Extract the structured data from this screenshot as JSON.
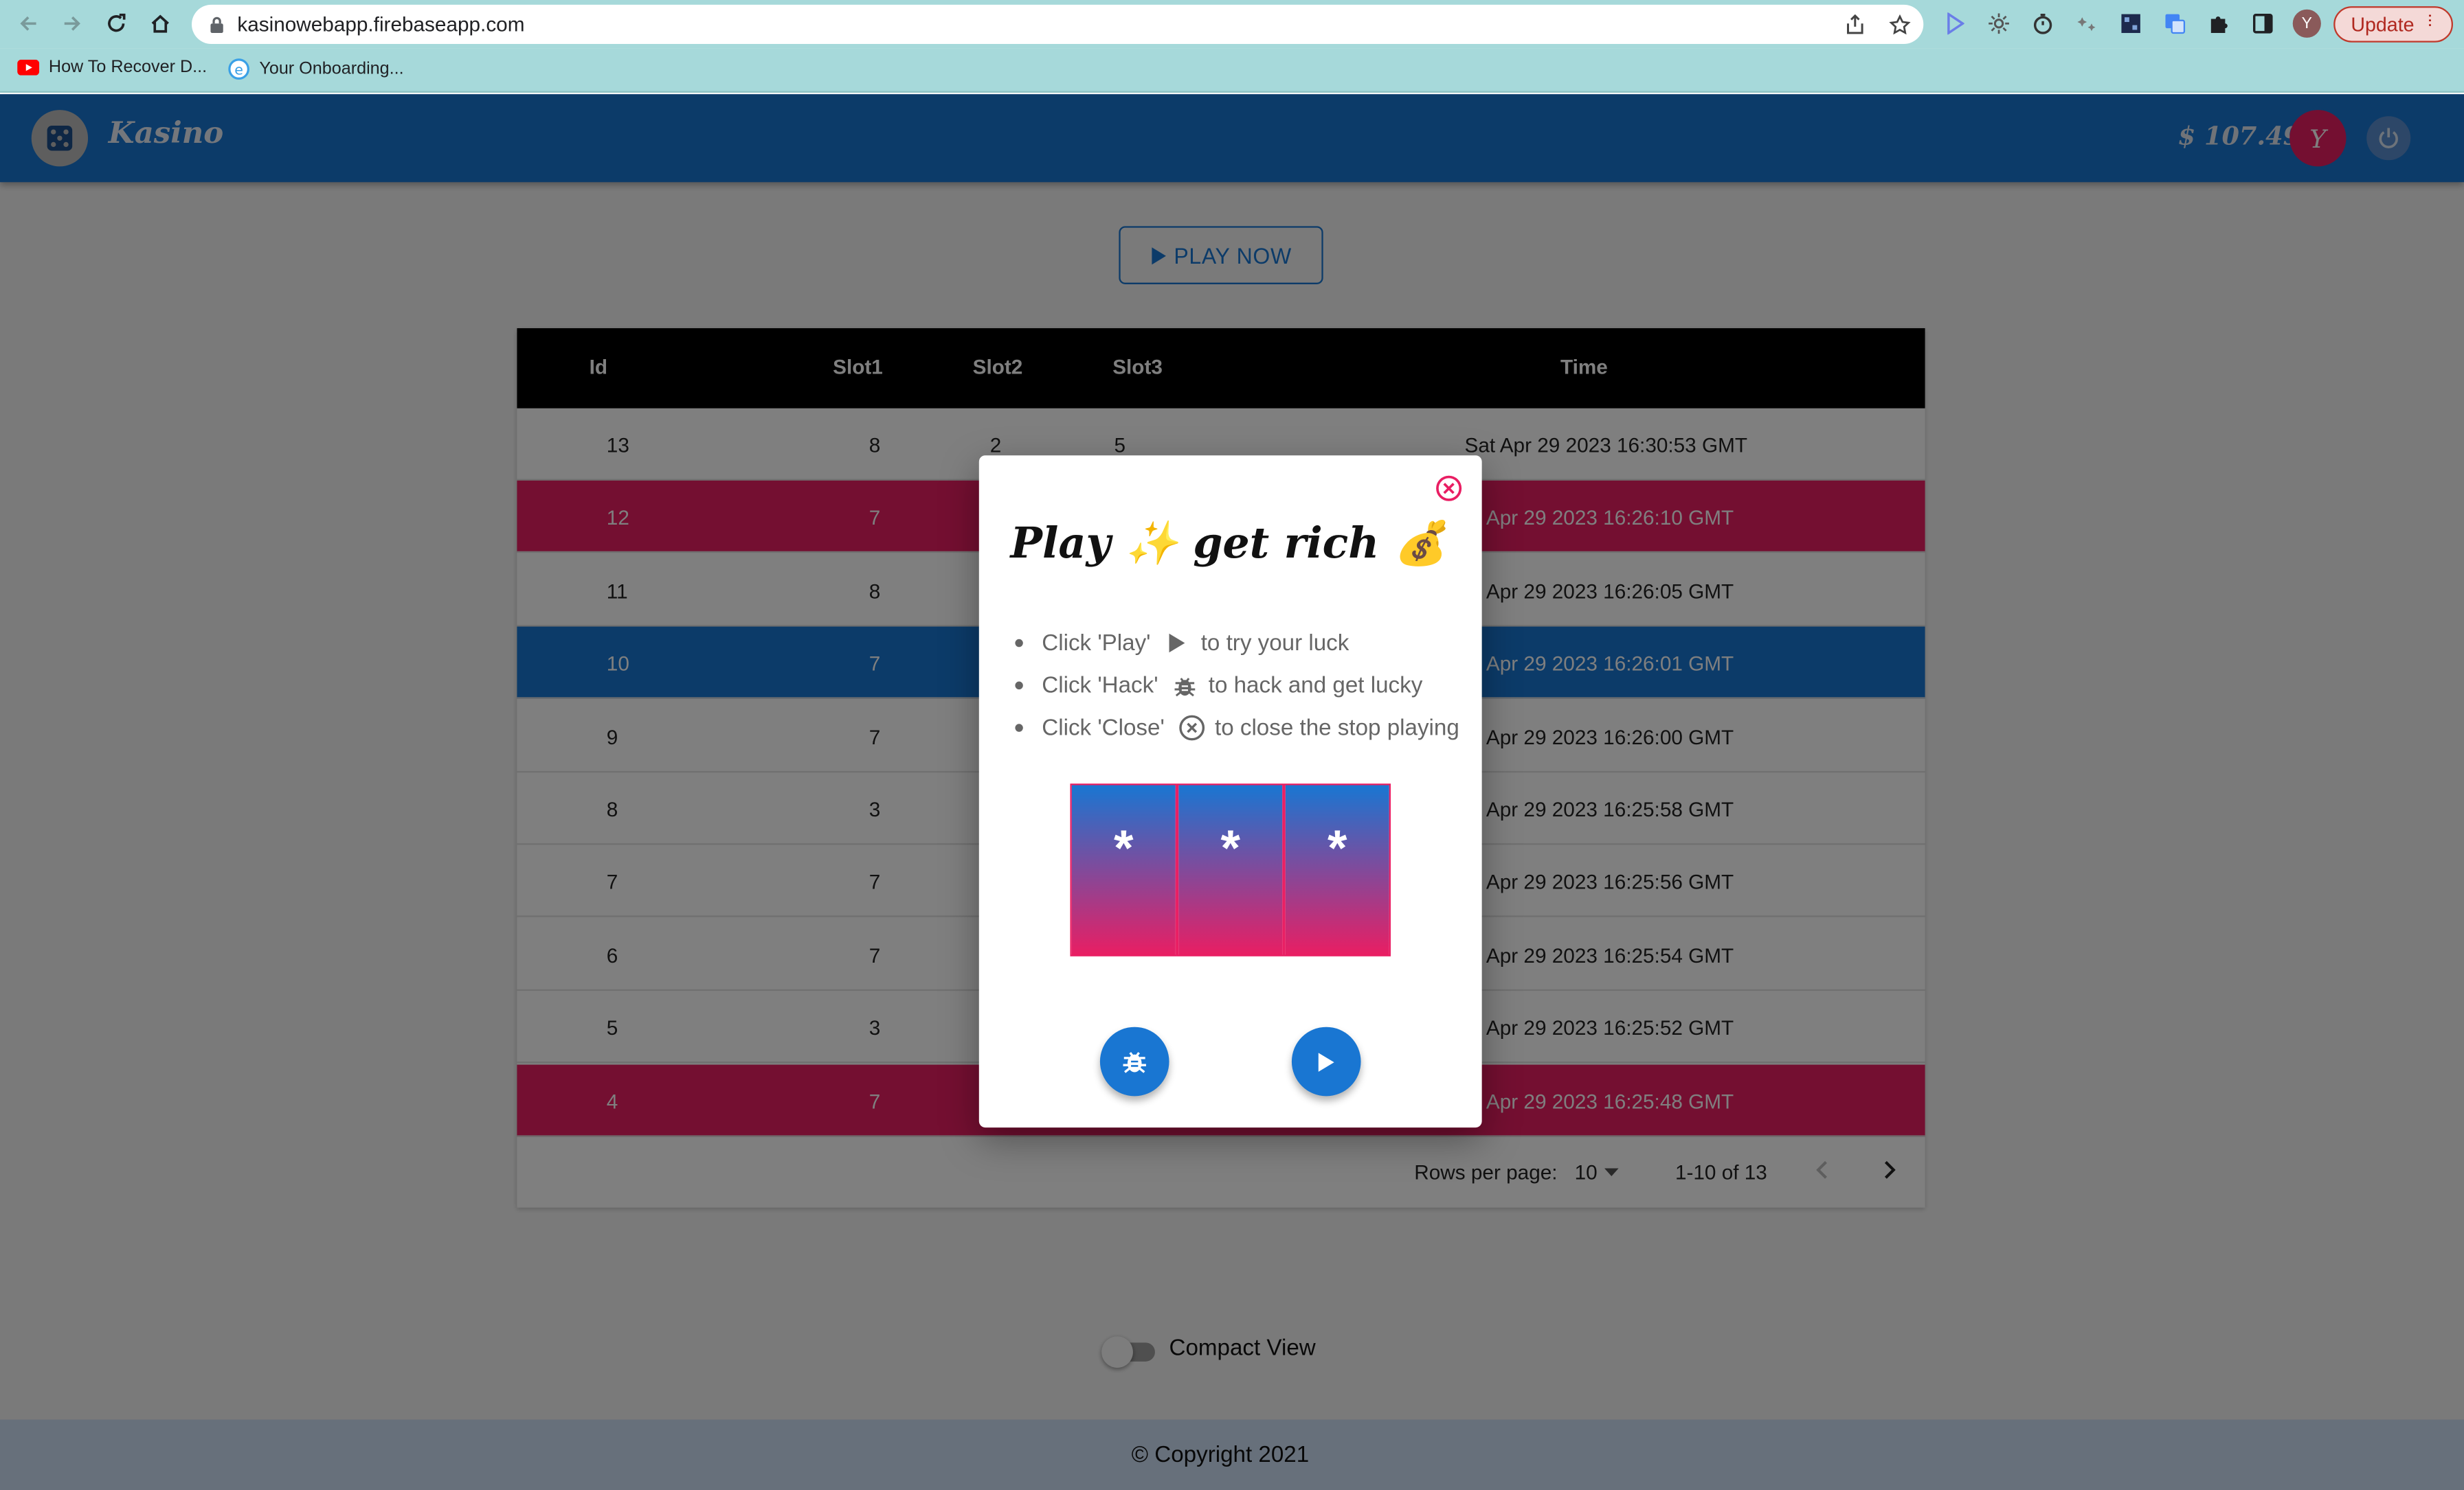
{
  "browser": {
    "url": "kasinowebapp.firebaseapp.com",
    "bookmarks": [
      {
        "label": "How To Recover D...",
        "icon": "youtube-icon"
      },
      {
        "label": "Your Onboarding...",
        "icon": "onboarding-icon"
      }
    ],
    "profile_initial": "Y",
    "update_label": "Update"
  },
  "app": {
    "brand": "Kasino",
    "balance": "$ 107.49",
    "avatar_initial": "Y",
    "play_now_label": "PLAY NOW",
    "colors": {
      "primary": "#1976d2",
      "accent": "#e91e63",
      "header": "#000000"
    }
  },
  "table": {
    "headers": {
      "id": "Id",
      "slot1": "Slot1",
      "slot2": "Slot2",
      "slot3": "Slot3",
      "time": "Time"
    },
    "rows": [
      {
        "id": "13",
        "slot1": "8",
        "slot2": "2",
        "slot3": "5",
        "time": "Sat Apr 29 2023 16:30:53 GMT",
        "highlight": "none"
      },
      {
        "id": "12",
        "slot1": "7",
        "time": "at Apr 29 2023 16:26:10 GMT",
        "highlight": "pink"
      },
      {
        "id": "11",
        "slot1": "8",
        "time": "at Apr 29 2023 16:26:05 GMT",
        "highlight": "none"
      },
      {
        "id": "10",
        "slot1": "7",
        "time": "at Apr 29 2023 16:26:01 GMT",
        "highlight": "blue"
      },
      {
        "id": "9",
        "slot1": "7",
        "time": "at Apr 29 2023 16:26:00 GMT",
        "highlight": "none"
      },
      {
        "id": "8",
        "slot1": "3",
        "time": "at Apr 29 2023 16:25:58 GMT",
        "highlight": "none"
      },
      {
        "id": "7",
        "slot1": "7",
        "time": "at Apr 29 2023 16:25:56 GMT",
        "highlight": "none"
      },
      {
        "id": "6",
        "slot1": "7",
        "time": "at Apr 29 2023 16:25:54 GMT",
        "highlight": "none"
      },
      {
        "id": "5",
        "slot1": "3",
        "time": "at Apr 29 2023 16:25:52 GMT",
        "highlight": "none"
      },
      {
        "id": "4",
        "slot1": "7",
        "time": "at Apr 29 2023 16:25:48 GMT",
        "highlight": "pink"
      }
    ],
    "pagination": {
      "rows_per_page_label": "Rows per page:",
      "rows_per_page": "10",
      "range": "1-10 of 13"
    }
  },
  "compact_view": {
    "label": "Compact View",
    "enabled": false
  },
  "footer": {
    "copyright": "© Copyright 2021"
  },
  "dialog": {
    "title": "Play ✨ get rich 💰",
    "instructions": [
      {
        "pre": "Click 'Play'",
        "icon": "play-icon",
        "post": "to try your luck"
      },
      {
        "pre": "Click 'Hack'",
        "icon": "bug-icon",
        "post": "to hack and get lucky"
      },
      {
        "pre": "Click 'Close'",
        "icon": "close-circle-icon",
        "post": "to close the stop playing"
      }
    ],
    "reels": [
      "*",
      "*",
      "*"
    ]
  }
}
